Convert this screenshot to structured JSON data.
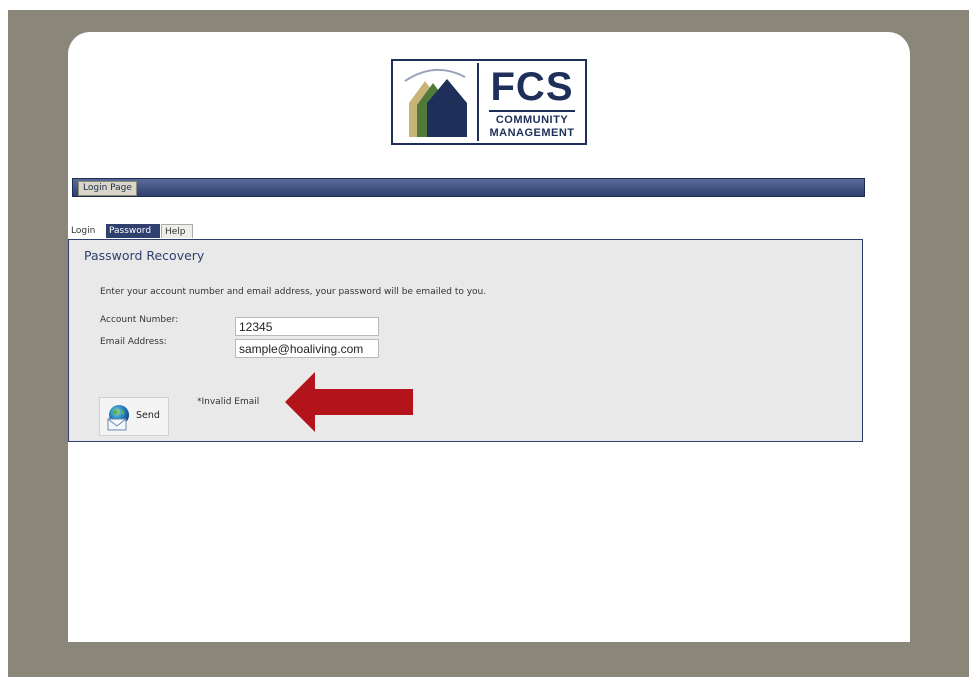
{
  "logo": {
    "name": "FCS",
    "line1": "COMMUNITY",
    "line2": "MANAGEMENT"
  },
  "header": {
    "breadcrumb": "Login Page"
  },
  "tabs": [
    {
      "label": "Login",
      "active": false
    },
    {
      "label": "Password",
      "active": true
    },
    {
      "label": "Help",
      "active": false
    }
  ],
  "panel": {
    "title": "Password Recovery",
    "instructions": "Enter your account number and email address, your password will be emailed to you.",
    "account_label": "Account Number:",
    "account_value": "12345",
    "email_label": "Email Address:",
    "email_value": "sample@hoaliving.com",
    "send_label": "Send",
    "error_text": "*Invalid Email"
  },
  "colors": {
    "brand_navy": "#1e2f5a",
    "header_bar": "#2f3f6e",
    "panel_bg": "#e9e9e9",
    "frame_bg": "#8a877a",
    "arrow_red": "#b3141c"
  },
  "icons": {
    "send": "globe-envelope-icon",
    "annotation": "left-arrow-icon",
    "logo": "houses-logo-icon"
  }
}
